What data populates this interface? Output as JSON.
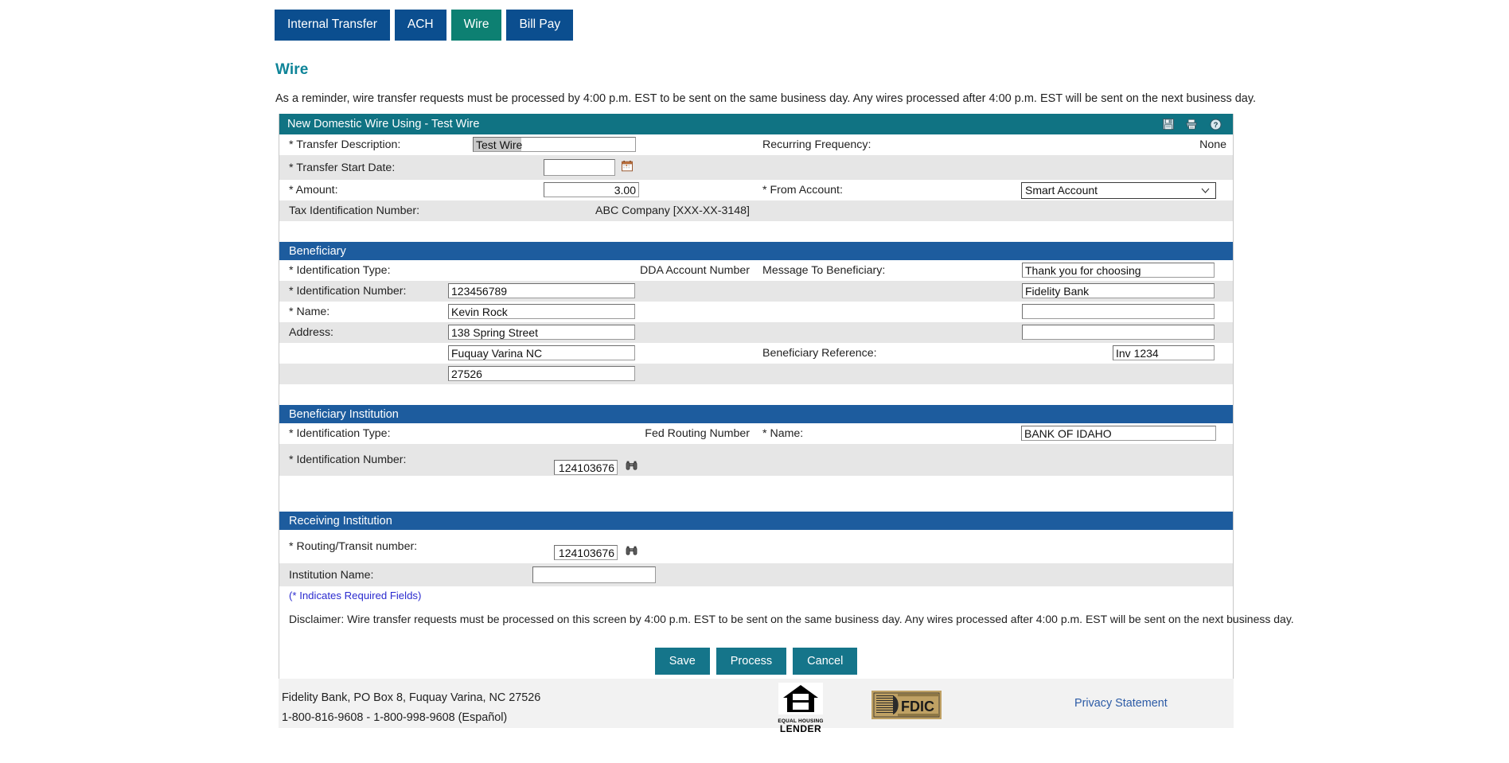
{
  "tabs": [
    {
      "label": "Internal Transfer",
      "active": false
    },
    {
      "label": "ACH",
      "active": false
    },
    {
      "label": "Wire",
      "active": true
    },
    {
      "label": "Bill Pay",
      "active": false
    }
  ],
  "page": {
    "title": "Wire",
    "reminder": "As a reminder, wire transfer requests must be processed by 4:00 p.m. EST to be sent on the same business day. Any wires processed after 4:00 p.m. EST will be sent on the next business day."
  },
  "panel": {
    "title": "New Domestic Wire Using - Test Wire",
    "icons": [
      "save-icon",
      "print-icon",
      "help-icon"
    ]
  },
  "main_section": {
    "transfer_description_label": "* Transfer Description:",
    "transfer_description_value": "Test Wire",
    "recurring_frequency_label": "Recurring Frequency:",
    "recurring_frequency_value": "None",
    "transfer_start_date_label": "* Transfer Start Date:",
    "transfer_start_date_value": "",
    "amount_label": "* Amount:",
    "amount_value": "3.00",
    "from_account_label": "* From Account:",
    "from_account_value": "Smart Account",
    "from_account_options": [
      "Smart Account"
    ],
    "tax_id_label": "Tax Identification Number:",
    "tax_id_value": "ABC Company [XXX-XX-3148]"
  },
  "beneficiary": {
    "section_title": "Beneficiary",
    "id_type_label": "* Identification Type:",
    "id_type_value": "DDA Account Number",
    "id_number_label": "* Identification Number:",
    "id_number_value": "123456789",
    "name_label": "* Name:",
    "name_value": "Kevin Rock",
    "address_label": "Address:",
    "address_line1": "138 Spring Street",
    "address_line2": "Fuquay Varina NC",
    "address_line3": "27526",
    "message_label": "Message To Beneficiary:",
    "message_line1": "Thank you for choosing",
    "message_line2": "Fidelity Bank",
    "message_line3": "",
    "message_line4": "",
    "reference_label": "Beneficiary Reference:",
    "reference_value": "Inv 1234"
  },
  "beneficiary_institution": {
    "section_title": "Beneficiary Institution",
    "id_type_label": "* Identification Type:",
    "id_type_value": "Fed Routing Number",
    "id_number_label": "* Identification Number:",
    "id_number_value": "124103676",
    "name_label": "* Name:",
    "name_value": "BANK OF IDAHO"
  },
  "receiving_institution": {
    "section_title": "Receiving Institution",
    "routing_label": "* Routing/Transit number:",
    "routing_value": "124103676",
    "institution_name_label": "Institution Name:",
    "institution_name_value": ""
  },
  "notes": {
    "required_fields": "(* Indicates Required Fields)",
    "disclaimer": "Disclaimer: Wire transfer requests must be processed on this screen by 4:00 p.m. EST to be sent on the same business day. Any wires processed after 4:00 p.m. EST will be sent on the next business day."
  },
  "buttons": {
    "save": "Save",
    "process": "Process",
    "cancel": "Cancel"
  },
  "footer": {
    "address": "Fidelity Bank, PO Box 8, Fuquay Varina, NC 27526",
    "phone": "1-800-816-9608 - 1-800-998-9608 (Español)",
    "equal_housing_line1": "EQUAL HOUSING",
    "equal_housing_line2": "LENDER",
    "fdic": "FDIC",
    "privacy": "Privacy Statement"
  },
  "colors": {
    "tab": "#0b4e8f",
    "tab_active": "#0d8072",
    "panel_header": "#107383",
    "section_bar": "#1d5c9e",
    "button": "#15758a",
    "heading": "#0e8498",
    "link": "#2c5ba6",
    "required_note": "#2b2bcf"
  }
}
